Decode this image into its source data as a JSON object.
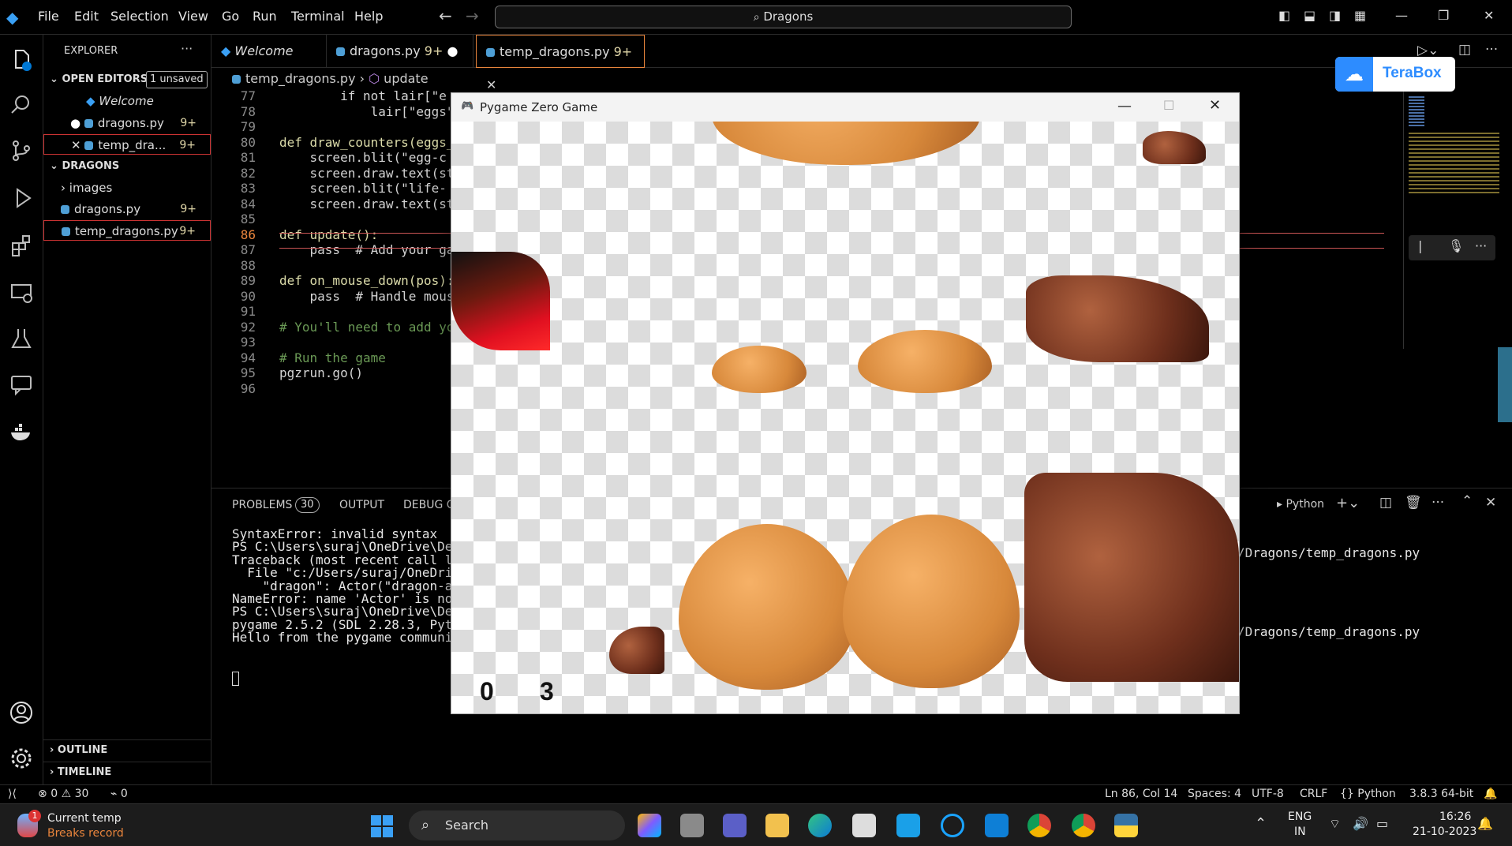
{
  "menu": {
    "items": [
      "File",
      "Edit",
      "Selection",
      "View",
      "Go",
      "Run",
      "Terminal",
      "Help"
    ],
    "search": "Dragons"
  },
  "sidebar": {
    "title": "EXPLORER",
    "open_editors": "OPEN EDITORS",
    "unsaved": "1 unsaved",
    "open_files": [
      {
        "name": "Welcome",
        "badge": ""
      },
      {
        "name": "dragons.py",
        "badge": "9+"
      },
      {
        "name": "temp_dra...",
        "badge": "9+"
      }
    ],
    "folder": "DRAGONS",
    "items": [
      {
        "name": "images",
        "badge": ""
      },
      {
        "name": "dragons.py",
        "badge": "9+"
      },
      {
        "name": "temp_dragons.py",
        "badge": "9+"
      }
    ],
    "outline": "OUTLINE",
    "timeline": "TIMELINE"
  },
  "tabs": [
    {
      "label": "Welcome"
    },
    {
      "label": "dragons.py",
      "badge": "9+"
    },
    {
      "label": "temp_dragons.py",
      "badge": "9+"
    }
  ],
  "breadcrumb": {
    "file": "temp_dragons.py",
    "symbol": "update"
  },
  "editor": {
    "lines": [
      {
        "n": "77",
        "t": "        if not lair[\"e"
      },
      {
        "n": "78",
        "t": "            lair[\"eggs\""
      },
      {
        "n": "79",
        "t": ""
      },
      {
        "n": "80",
        "t": "def draw_counters(eggs_"
      },
      {
        "n": "81",
        "t": "    screen.blit(\"egg-c"
      },
      {
        "n": "82",
        "t": "    screen.draw.text(st"
      },
      {
        "n": "83",
        "t": "    screen.blit(\"life-"
      },
      {
        "n": "84",
        "t": "    screen.draw.text(st"
      },
      {
        "n": "85",
        "t": ""
      },
      {
        "n": "86",
        "t": "def update():"
      },
      {
        "n": "87",
        "t": "    pass  # Add your ga"
      },
      {
        "n": "88",
        "t": ""
      },
      {
        "n": "89",
        "t": "def on_mouse_down(pos):"
      },
      {
        "n": "90",
        "t": "    pass  # Handle mous"
      },
      {
        "n": "91",
        "t": ""
      },
      {
        "n": "92",
        "t": "# You'll need to add yo"
      },
      {
        "n": "93",
        "t": ""
      },
      {
        "n": "94",
        "t": "# Run the game"
      },
      {
        "n": "95",
        "t": "pgzrun.go()"
      },
      {
        "n": "96",
        "t": ""
      }
    ]
  },
  "panel": {
    "tabs": [
      "PROBLEMS",
      "OUTPUT",
      "DEBUG CO"
    ],
    "problems_count": "30",
    "shell": "Python",
    "terminal": [
      "SyntaxError: invalid syntax",
      "PS C:\\Users\\suraj\\OneDrive\\Desk",
      "Traceback (most recent call las",
      "  File \"c:/Users/suraj/OneDrive",
      "    \"dragon\": Actor(\"dragon-asl",
      "NameError: name 'Actor' is not",
      "PS C:\\Users\\suraj\\OneDrive\\Desk",
      "pygame 2.5.2 (SDL 2.28.3, Pytho",
      "Hello from the pygame community"
    ],
    "terminal_right": [
      "/Dragons/temp_dragons.py",
      "/Dragons/temp_dragons.py"
    ]
  },
  "pygame": {
    "title": "Pygame Zero Game",
    "eggs": "0",
    "lives": "3"
  },
  "terabox": {
    "label": "TeraBox"
  },
  "status": {
    "errors": "0",
    "warnings": "30",
    "ports": "0",
    "position": "Ln 86, Col 14",
    "spaces": "Spaces: 4",
    "encoding": "UTF-8",
    "eol": "CRLF",
    "language": "Python",
    "interpreter": "3.8.3 64-bit"
  },
  "taskbar": {
    "weather_title": "Current temp",
    "weather_sub": "Breaks record",
    "weather_badge": "1",
    "search": "Search",
    "lang1": "ENG",
    "lang2": "IN",
    "time": "16:26",
    "date": "21-10-2023"
  },
  "colors": {
    "accent": "#0078d4",
    "error_border": "#f14c4c",
    "tab_active_border": "#e8843c"
  }
}
